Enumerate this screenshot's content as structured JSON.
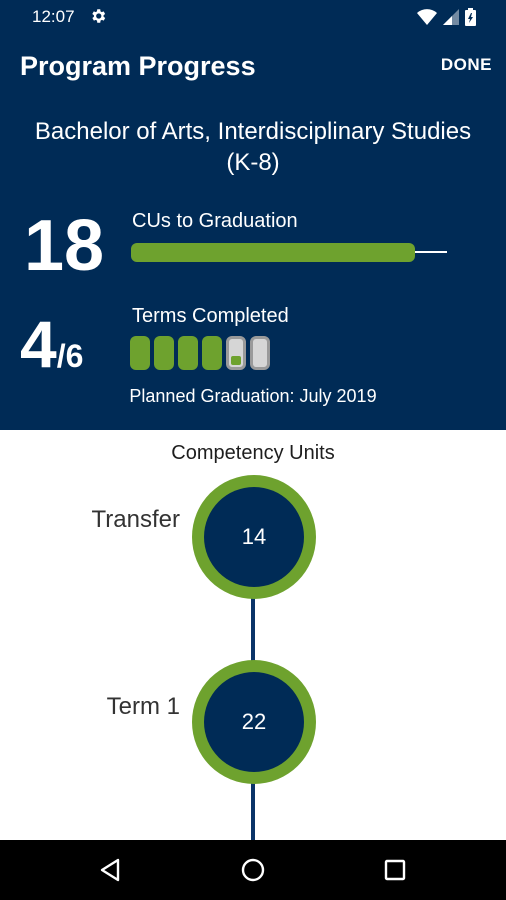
{
  "status_bar": {
    "time": "12:07",
    "icons": [
      "gear-icon",
      "wifi-icon",
      "cell-signal-icon",
      "battery-icon"
    ]
  },
  "header": {
    "title": "Program Progress",
    "done_label": "DONE",
    "program_name_line1": "Bachelor of Arts, Interdisciplinary Studies",
    "program_name_line2": "(K-8)",
    "cus_to_graduation": {
      "value": "18",
      "label": "CUs to Graduation",
      "progress_fraction": 0.9
    },
    "terms": {
      "completed": "4",
      "total": "/6",
      "label": "Terms Completed",
      "pills": [
        "complete",
        "complete",
        "complete",
        "complete",
        "partial",
        "empty"
      ]
    },
    "planned_graduation": "Planned Graduation: July 2019"
  },
  "competency_units": {
    "title": "Competency Units",
    "nodes": [
      {
        "label": "Transfer",
        "value": "14"
      },
      {
        "label": "Term 1",
        "value": "22"
      }
    ]
  },
  "colors": {
    "brand_navy": "#002b56",
    "accent_green": "#6ea22e"
  },
  "nav_bar": {
    "icons": [
      "back-triangle-icon",
      "home-circle-icon",
      "recents-square-icon"
    ]
  }
}
